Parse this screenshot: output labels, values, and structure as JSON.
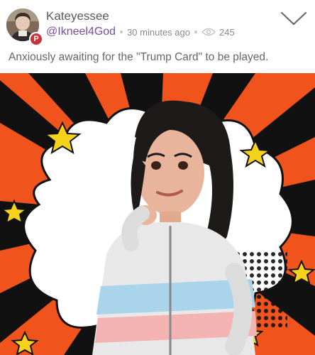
{
  "post": {
    "author_name": "Kateyessee",
    "handle": "@Ikneel4God",
    "timestamp": "30 minutes ago",
    "views": "245",
    "text": "Anxiously awaiting for the \"Trump Card\" to be played.",
    "badge_icon": "parler-p-icon",
    "badge_glyph": "P",
    "options_icon": "chevron-down-icon",
    "views_icon": "eye-icon",
    "image_description_icon": "cartoon-avatar-image"
  },
  "colors": {
    "handle": "#7b4aa0",
    "badge": "#c8303b",
    "burst_orange": "#f0541c",
    "star_yellow": "#f6d21a"
  }
}
